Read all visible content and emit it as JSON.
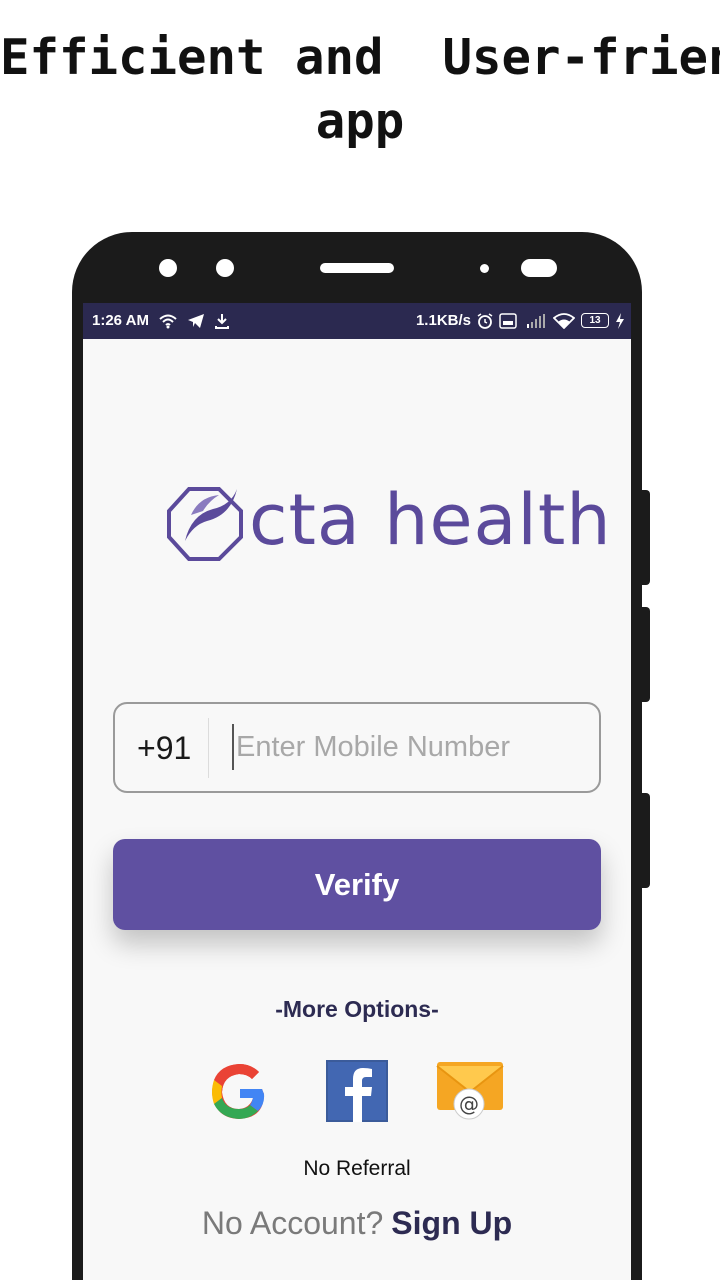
{
  "headline": {
    "line1": "Efficient and  User-friendly",
    "line2": "app"
  },
  "statusbar": {
    "time": "1:26 AM",
    "speed": "1.1KB/s",
    "battery": "13",
    "left_icons": [
      "wifi-hotspot-icon",
      "telegram-icon",
      "download-icon"
    ],
    "right_icons": [
      "alarm-icon",
      "volte-icon",
      "signal-icon",
      "wifi-icon",
      "battery-icon",
      "charging-icon"
    ]
  },
  "logo": {
    "text": "cta health",
    "color": "#5b4a9b"
  },
  "login": {
    "country_code": "+91",
    "mobile_placeholder": "Enter Mobile Number",
    "mobile_value": "",
    "verify_label": "Verify",
    "more_options": "-More Options-",
    "social": [
      "google-icon",
      "facebook-icon",
      "email-icon"
    ],
    "no_referral": "No Referral",
    "no_account": "No Account?",
    "sign_up": "Sign Up"
  },
  "colors": {
    "accent": "#5f50a1",
    "statusbar": "#2b2950",
    "dark_text": "#2d2b52"
  }
}
